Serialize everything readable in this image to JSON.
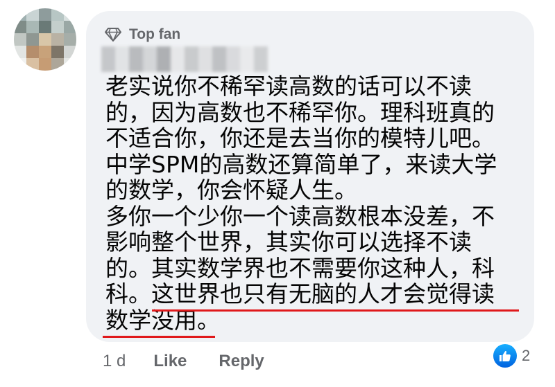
{
  "comment": {
    "badge": {
      "icon": "diamond-icon",
      "label": "Top fan"
    },
    "lines": [
      "老实说你不稀罕读高数的话可以不读",
      "的，因为高数也不稀罕你。理科班真的",
      "不适合你，你还是去当你的模特儿吧。",
      "中学SPM的高数还算简单了，来读大学",
      "的数学，你会怀疑人生。",
      "多你一个少你一个读高数根本没差，不",
      "影响整个世界，其实你可以选择不读",
      "的。其实数学界也不需要你这种人，科",
      "科。这世界也只有无脑的人才会觉得读",
      "数学没用。"
    ]
  },
  "actions": {
    "time": "1 d",
    "like_label": "Like",
    "reply_label": "Reply"
  },
  "reactions": {
    "icon": "thumbs-up-icon",
    "count": "2"
  },
  "colors": {
    "bubble": "#f0f2f5",
    "secondary_text": "#65676b",
    "underline": "#e0191b",
    "like_blue": "#1877f2"
  }
}
